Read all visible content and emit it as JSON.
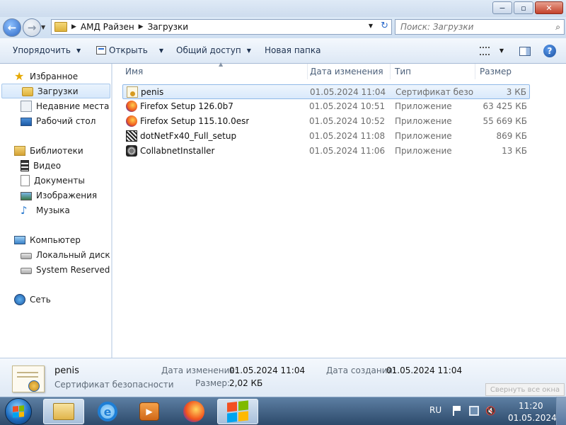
{
  "window": {
    "buttons": {
      "minimize": "−",
      "maximize": "▫",
      "close": "✕"
    }
  },
  "address": {
    "back_icon": "back-arrow-icon",
    "forward_icon": "forward-arrow-icon",
    "crumbs": [
      "АМД Райзен",
      "Загрузки"
    ],
    "search_placeholder": "Поиск: Загрузки"
  },
  "toolbar": {
    "organize": "Упорядочить",
    "open": "Открыть",
    "share": "Общий доступ",
    "new_folder": "Новая папка"
  },
  "sidebar": {
    "favorites": "Избранное",
    "downloads": "Загрузки",
    "recent": "Недавние места",
    "desktop": "Рабочий стол",
    "libraries": "Библиотеки",
    "video": "Видео",
    "documents": "Документы",
    "pictures": "Изображения",
    "music": "Музыка",
    "computer": "Компьютер",
    "local_disk": "Локальный диск (C",
    "system_reserved": "System Reserved (D:",
    "network": "Сеть"
  },
  "columns": {
    "name": "Имя",
    "date": "Дата изменения",
    "type": "Тип",
    "size": "Размер"
  },
  "files": [
    {
      "name": "penis",
      "date": "01.05.2024 11:04",
      "type": "Сертификат безо...",
      "size": "3 КБ",
      "icon": "certificate-icon"
    },
    {
      "name": "Firefox Setup 126.0b7",
      "date": "01.05.2024 10:51",
      "type": "Приложение",
      "size": "63 425 КБ",
      "icon": "firefox-installer-icon"
    },
    {
      "name": "Firefox Setup 115.10.0esr",
      "date": "01.05.2024 10:52",
      "type": "Приложение",
      "size": "55 669 КБ",
      "icon": "firefox-installer-icon"
    },
    {
      "name": "dotNetFx40_Full_setup",
      "date": "01.05.2024 11:08",
      "type": "Приложение",
      "size": "869 КБ",
      "icon": "dotnet-installer-icon"
    },
    {
      "name": "CollabnetInstaller",
      "date": "01.05.2024 11:06",
      "type": "Приложение",
      "size": "13 КБ",
      "icon": "installer-icon"
    }
  ],
  "details": {
    "name": "penis",
    "type": "Сертификат безопасности",
    "modified_label": "Дата изменения:",
    "modified_value": "01.05.2024 11:04",
    "created_label": "Дата создания:",
    "created_value": "01.05.2024 11:04",
    "size_label": "Размер:",
    "size_value": "2,02 КБ"
  },
  "taskbar": {
    "language": "RU",
    "time": "11:20",
    "date": "01.05.2024",
    "ie_glyph": "e",
    "wmp_glyph": "▶",
    "volume_glyph": "🔇",
    "tooltip": "Свернуть все окна"
  }
}
